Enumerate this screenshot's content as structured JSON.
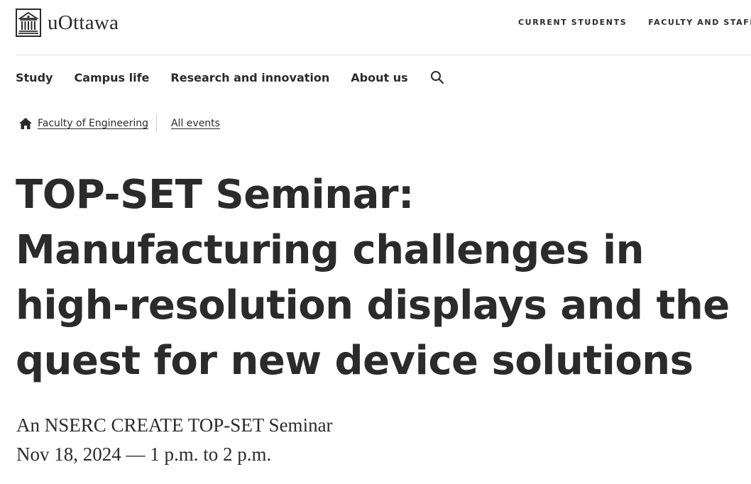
{
  "header": {
    "logo_text": "uOttawa",
    "audience_links": [
      "CURRENT STUDENTS",
      "FACULTY AND STAFF"
    ]
  },
  "nav": {
    "items": [
      "Study",
      "Campus life",
      "Research and innovation",
      "About us"
    ],
    "search_icon": "search-icon"
  },
  "breadcrumb": {
    "home_icon": "home-icon",
    "items": [
      "Faculty of Engineering",
      "All events"
    ]
  },
  "event": {
    "title": "TOP-SET Seminar: Manufacturing challenges in high-resolution displays and the quest for new device solutions",
    "subtitle": "An NSERC CREATE TOP-SET Seminar",
    "date": "Nov 18, 2024 — 1 p.m. to 2 p.m."
  },
  "colors": {
    "text": "#2b2b2b",
    "rule": "#dcdcdc",
    "background": "#ffffff"
  }
}
